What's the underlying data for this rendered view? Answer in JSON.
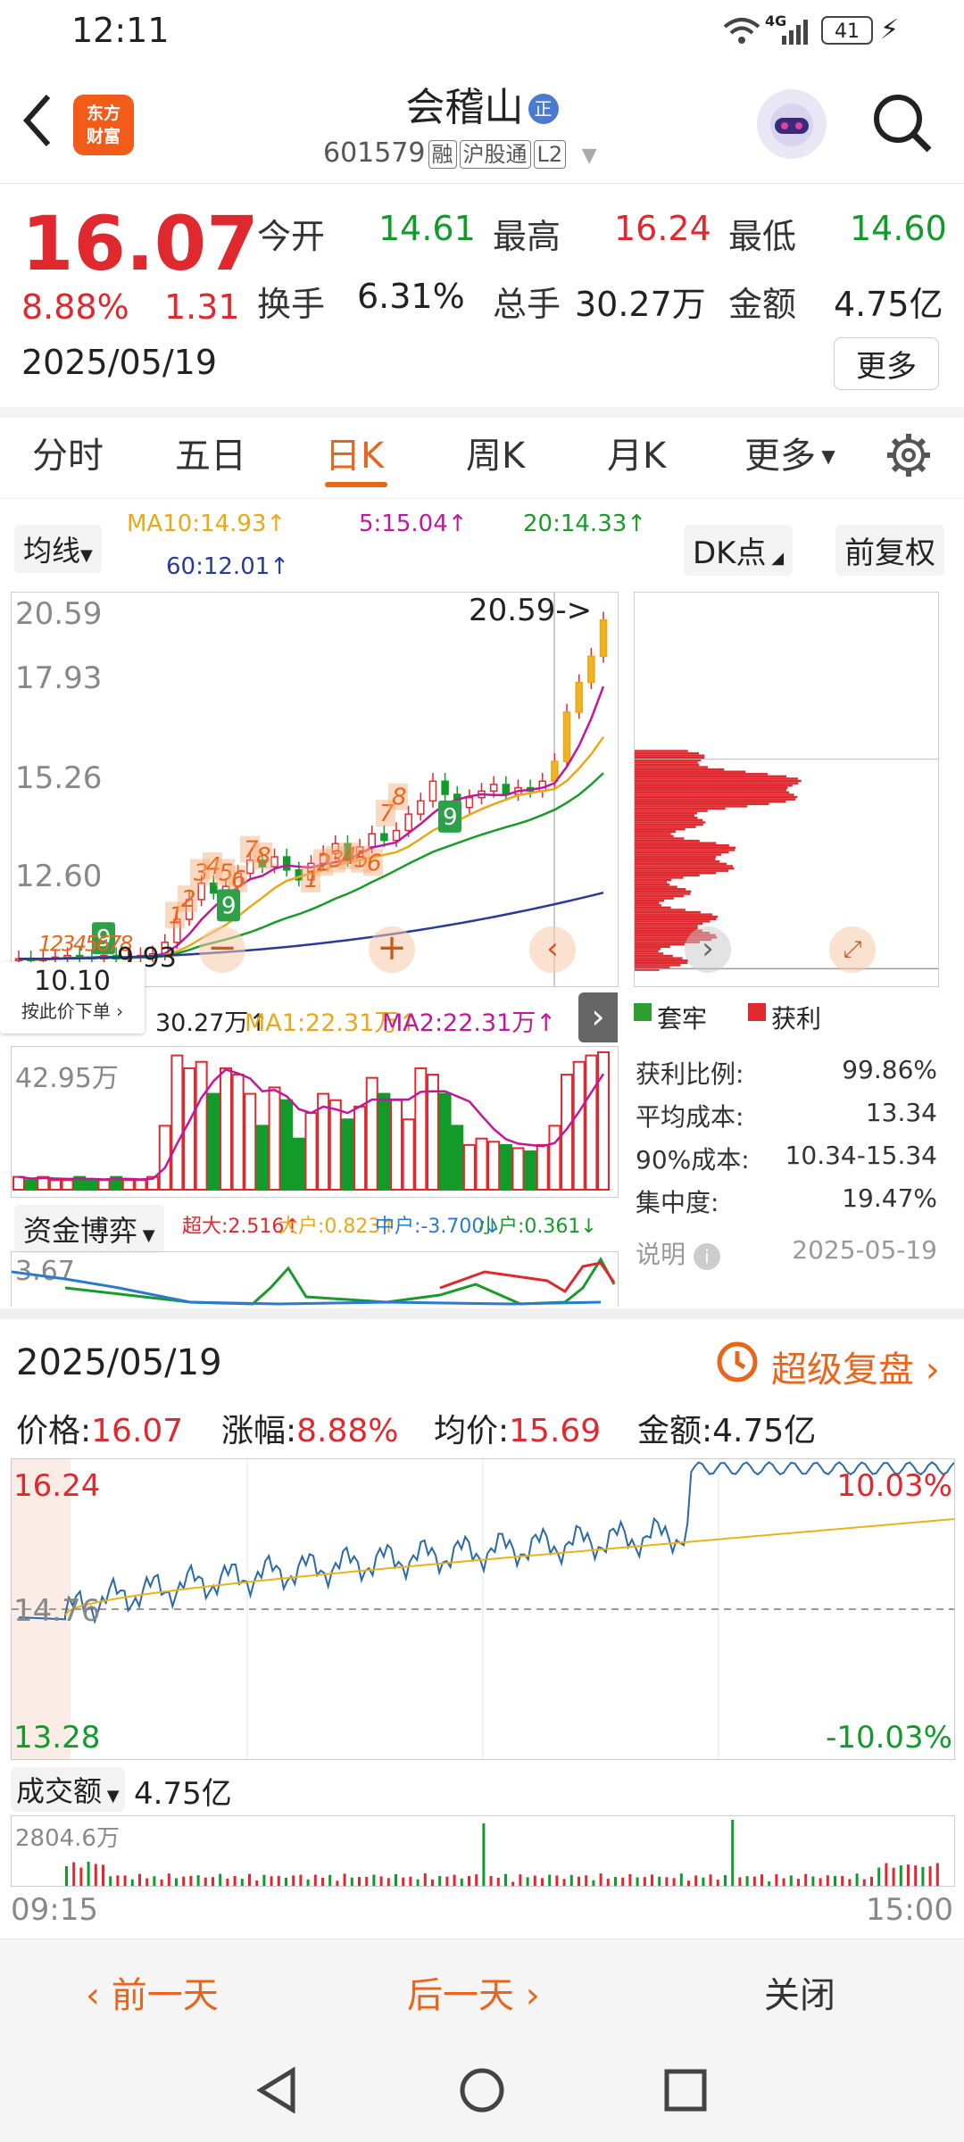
{
  "status": {
    "time": "12:11",
    "net": "4G",
    "battery": "41"
  },
  "header": {
    "logo_line1": "东方",
    "logo_line2": "财富",
    "name": "会稽山",
    "tag": "正",
    "code": "601579",
    "badges": [
      "融",
      "沪股通",
      "L2"
    ]
  },
  "quote": {
    "price": "16.07",
    "pct": "8.88%",
    "chg": "1.31",
    "date": "2025/05/19",
    "fields": [
      {
        "label": "今开",
        "value": "14.61",
        "color": "green"
      },
      {
        "label": "最高",
        "value": "16.24",
        "color": "red"
      },
      {
        "label": "最低",
        "value": "14.60",
        "color": "green"
      },
      {
        "label": "换手",
        "value": "6.31%",
        "color": "black"
      },
      {
        "label": "总手",
        "value": "30.27万",
        "color": "black"
      },
      {
        "label": "金额",
        "value": "4.75亿",
        "color": "black"
      }
    ],
    "more": "更多"
  },
  "tabs": [
    "分时",
    "五日",
    "日K",
    "周K",
    "月K",
    "更多"
  ],
  "active_tab": "日K",
  "ma": {
    "select": "均线",
    "ma10": "MA10:14.93↑",
    "ma5": "5:15.04↑",
    "ma20": "20:14.33↑",
    "ma60": "60:12.01↑",
    "dk": "DK点",
    "fq": "前复权"
  },
  "kchart": {
    "price_labels": [
      "20.59",
      "17.93",
      "15.26",
      "12.60"
    ],
    "last_marker": "20.59->",
    "low_marker": "9.93",
    "tooltip_price": "10.10",
    "tooltip_action": "按此价下单",
    "vol_line": "30.27万↑",
    "vol_ma1": "MA1:22.31万↑",
    "vol_ma2": "MA2:22.31万↑",
    "vol_max": "42.95万",
    "fund_select": "资金博弈",
    "fund_super": "超大:2.516↑",
    "fund_big": "大户:0.823↑",
    "fund_mid": "中户:-3.700↓",
    "fund_small": "小户:0.361↓",
    "fund_max": "3.67",
    "closes": [
      10.0,
      9.95,
      10.0,
      10.05,
      10.1,
      10.05,
      10.0,
      10.1,
      10.0,
      10.05,
      10.1,
      10.15,
      10.5,
      11.2,
      11.8,
      12.3,
      12.0,
      12.2,
      12.6,
      13.0,
      12.8,
      13.1,
      12.7,
      12.4,
      12.9,
      13.2,
      13.5,
      13.0,
      13.4,
      13.8,
      13.6,
      13.9,
      14.4,
      14.8,
      15.4,
      15.0,
      14.6,
      14.9,
      15.1,
      15.3,
      15.0,
      15.2,
      15.1,
      15.4,
      16.0,
      17.5,
      18.4,
      19.2,
      20.3
    ],
    "volumes": [
      4,
      3,
      4,
      3,
      3,
      4,
      3,
      3,
      4,
      3,
      3,
      4,
      20,
      42,
      38,
      40,
      30,
      38,
      36,
      30,
      20,
      32,
      28,
      16,
      24,
      30,
      28,
      22,
      26,
      35,
      30,
      28,
      22,
      38,
      36,
      30,
      20,
      14,
      16,
      15,
      14,
      13,
      12,
      14,
      20,
      36,
      40,
      42,
      43
    ],
    "ma5_last": 15.04,
    "ma10_last": 14.93,
    "ma20_last": 14.33,
    "ma60_last": 12.01
  },
  "chips": {
    "legend_trap": "套牢",
    "legend_profit": "获利",
    "rows": [
      {
        "label": "获利比例:",
        "value": "99.86%"
      },
      {
        "label": "平均成本:",
        "value": "13.34"
      },
      {
        "label": "90%成本:",
        "value": "10.34-15.34"
      },
      {
        "label": "集中度:",
        "value": "19.47%"
      }
    ],
    "note": "说明",
    "date": "2025-05-19"
  },
  "intraday": {
    "date": "2025/05/19",
    "replay": "超级复盘",
    "price_label": "价格:",
    "price": "16.07",
    "pct_label": "涨幅:",
    "pct": "8.88%",
    "avg_label": "均价:",
    "avg": "15.69",
    "amt_label": "金额:",
    "amt": "4.75亿",
    "top": "16.24",
    "mid": "14.76",
    "bottom": "13.28",
    "top_pct": "10.03%",
    "bottom_pct": "-10.03%",
    "vol_select": "成交额",
    "vol_total": "4.75亿",
    "vol_max": "2804.6万",
    "start": "09:15",
    "end": "15:00"
  },
  "bottom": {
    "prev": "前一天",
    "next": "后一天",
    "close": "关闭"
  }
}
